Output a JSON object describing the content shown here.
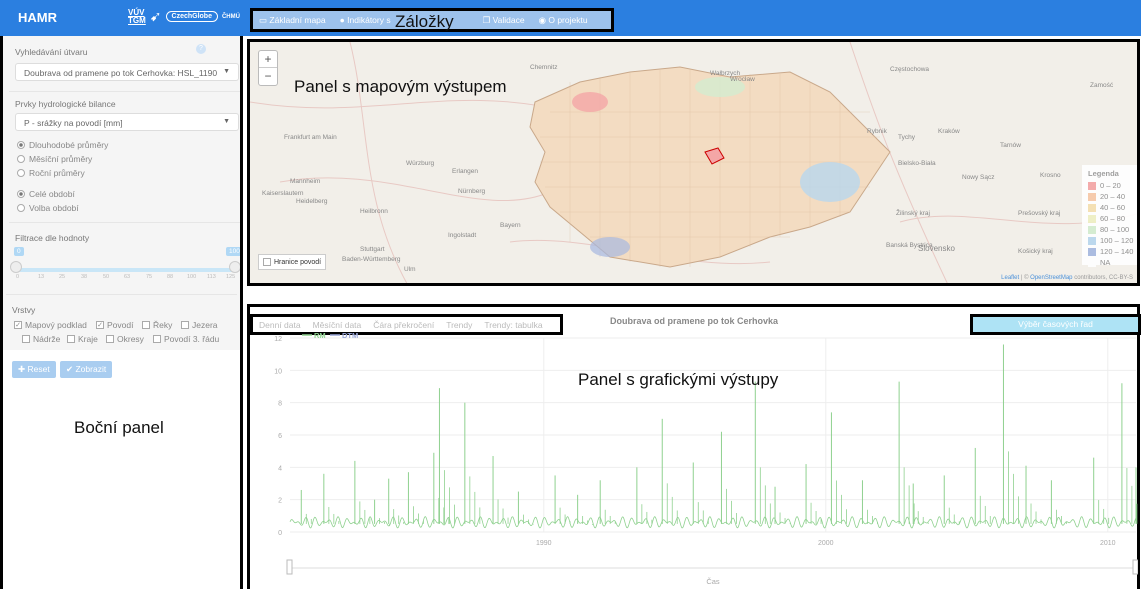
{
  "app": {
    "name": "HAMR",
    "logo_vuv_top": "VÚV",
    "logo_vuv_bottom": "TGM",
    "logo_czechglobe": "CzechGlobe",
    "logo_chmu": "ČHMÚ"
  },
  "tabs": [
    {
      "label": "Základní mapa",
      "icon": "map-icon"
    },
    {
      "label": "Indikátory s",
      "icon": "drop-icon"
    },
    {
      "label": "Validace",
      "icon": "copy-icon"
    },
    {
      "label": "O projektu",
      "icon": "info-icon"
    }
  ],
  "annotations": {
    "tabs": "Záložky",
    "map_panel": "Panel s mapovým výstupem",
    "chart_panel": "Panel s grafickými výstupy",
    "side_panel": "Boční panel"
  },
  "sidebar": {
    "catchment_label": "Vyhledávání útvaru",
    "help": "?",
    "catchment_value": "Doubrava od pramene po tok Cerhovka: HSL_1190",
    "balance_label": "Prvky hydrologické bilance",
    "balance_value": "P - srážky na povodí [mm]",
    "averages": [
      "Dlouhodobé průměry",
      "Měsíční průměry",
      "Roční průměry"
    ],
    "periods": [
      "Celé období",
      "Volba období"
    ],
    "filter_label": "Filtrace dle hodnoty",
    "filter_min": "0",
    "filter_max": "100",
    "filter_ticks": [
      "0",
      "13",
      "25",
      "38",
      "50",
      "63",
      "75",
      "88",
      "100",
      "113",
      "125"
    ],
    "layers_label": "Vrstvy",
    "layers_row1": [
      {
        "label": "Mapový podklad",
        "checked": true
      },
      {
        "label": "Povodí",
        "checked": true
      },
      {
        "label": "Řeky",
        "checked": false
      },
      {
        "label": "Jezera",
        "checked": false
      }
    ],
    "layers_row2": [
      {
        "label": "Nádrže",
        "checked": false
      },
      {
        "label": "Kraje",
        "checked": false
      },
      {
        "label": "Okresy",
        "checked": false
      },
      {
        "label": "Povodí 3. řádu",
        "checked": false
      }
    ],
    "reset_label": "Reset",
    "show_label": "Zobrazit"
  },
  "map": {
    "zoom_in": "+",
    "zoom_out": "−",
    "show_catchments": "Hranice povodí",
    "legend_title": "Legenda",
    "legend": [
      {
        "label": "0 – 20",
        "color": "#f4a6a6"
      },
      {
        "label": "20 – 40",
        "color": "#f7c9a8"
      },
      {
        "label": "40 – 60",
        "color": "#f5dfb0"
      },
      {
        "label": "60 – 80",
        "color": "#eef0c4"
      },
      {
        "label": "80 – 100",
        "color": "#d3ecd0"
      },
      {
        "label": "100 – 120",
        "color": "#b8d7ee"
      },
      {
        "label": "120 – 140",
        "color": "#a6b8e0"
      },
      {
        "label": "NA",
        "color": "#ffffff"
      }
    ],
    "attribution_leaflet": "Leaflet",
    "attribution_osm": "OpenStreetMap",
    "attribution_rest": "contributors, CC-BY-S",
    "cities": [
      {
        "name": "Wrocław"
      },
      {
        "name": "Chemnitz"
      },
      {
        "name": "Wałbrzych"
      },
      {
        "name": "Częstochowa"
      },
      {
        "name": "Frankfurt am Main"
      },
      {
        "name": "Würzburg"
      },
      {
        "name": "Mannheim"
      },
      {
        "name": "Erlangen"
      },
      {
        "name": "Nürnberg"
      },
      {
        "name": "Kaiserslautern"
      },
      {
        "name": "Heidelberg"
      },
      {
        "name": "Heilbronn"
      },
      {
        "name": "Stuttgart"
      },
      {
        "name": "Ingolstadt"
      },
      {
        "name": "Baden-Württemberg"
      },
      {
        "name": "Ulm"
      },
      {
        "name": "Bayern"
      },
      {
        "name": "Kraków"
      },
      {
        "name": "Tarnów"
      },
      {
        "name": "Rybnik"
      },
      {
        "name": "Tychy"
      },
      {
        "name": "Bielsko-Biała"
      },
      {
        "name": "Nowy Sącz"
      },
      {
        "name": "Krosno"
      },
      {
        "name": "Slovensko"
      },
      {
        "name": "Banská Bystrica"
      },
      {
        "name": "Žilinský kraj"
      },
      {
        "name": "Prešovský kraj"
      },
      {
        "name": "Košický kraj"
      },
      {
        "name": "Zamość"
      }
    ]
  },
  "chart_tabs": [
    "Denní data",
    "Měsíční data",
    "Čára překročení",
    "Trendy",
    "Trendy: tabulka"
  ],
  "chart_select_button": "Výběr časových řad",
  "chart_data": {
    "type": "line",
    "title": "Doubrava od pramene po tok Cerhovka",
    "xlabel": "Čas",
    "ylabel": "",
    "x_range": [
      1981,
      2011
    ],
    "ylim": [
      0,
      12
    ],
    "y_ticks": [
      "0",
      "2",
      "4",
      "6",
      "8",
      "10",
      "12"
    ],
    "x_ticks": [
      "1990",
      "2000",
      "2010"
    ],
    "series": [
      {
        "name": "RM",
        "color": "#8fd18f"
      },
      {
        "name": "DTM",
        "color": "#9aa7d8"
      }
    ],
    "peaks": [
      {
        "year": 1981.4,
        "value": 2.6
      },
      {
        "year": 1982.2,
        "value": 3.6
      },
      {
        "year": 1983.3,
        "value": 4.4
      },
      {
        "year": 1984.0,
        "value": 2.0
      },
      {
        "year": 1984.5,
        "value": 3.3
      },
      {
        "year": 1985.2,
        "value": 3.7
      },
      {
        "year": 1986.1,
        "value": 4.9
      },
      {
        "year": 1986.3,
        "value": 8.9
      },
      {
        "year": 1987.2,
        "value": 8.0
      },
      {
        "year": 1988.2,
        "value": 4.7
      },
      {
        "year": 1989.1,
        "value": 2.5
      },
      {
        "year": 1990.4,
        "value": 3.5
      },
      {
        "year": 1991.2,
        "value": 2.3
      },
      {
        "year": 1992.0,
        "value": 3.2
      },
      {
        "year": 1993.3,
        "value": 4.0
      },
      {
        "year": 1994.2,
        "value": 7.0
      },
      {
        "year": 1995.3,
        "value": 4.3
      },
      {
        "year": 1996.3,
        "value": 6.2
      },
      {
        "year": 1997.5,
        "value": 9.3
      },
      {
        "year": 1998.2,
        "value": 2.8
      },
      {
        "year": 1999.3,
        "value": 4.2
      },
      {
        "year": 2000.2,
        "value": 7.4
      },
      {
        "year": 2001.3,
        "value": 3.2
      },
      {
        "year": 2002.6,
        "value": 9.3
      },
      {
        "year": 2003.1,
        "value": 3.0
      },
      {
        "year": 2004.2,
        "value": 3.5
      },
      {
        "year": 2005.3,
        "value": 5.2
      },
      {
        "year": 2006.3,
        "value": 11.6
      },
      {
        "year": 2007.1,
        "value": 4.1
      },
      {
        "year": 2008.0,
        "value": 3.2
      },
      {
        "year": 2009.5,
        "value": 4.6
      },
      {
        "year": 2010.5,
        "value": 9.2
      },
      {
        "year": 2011.0,
        "value": 4.0
      }
    ]
  }
}
